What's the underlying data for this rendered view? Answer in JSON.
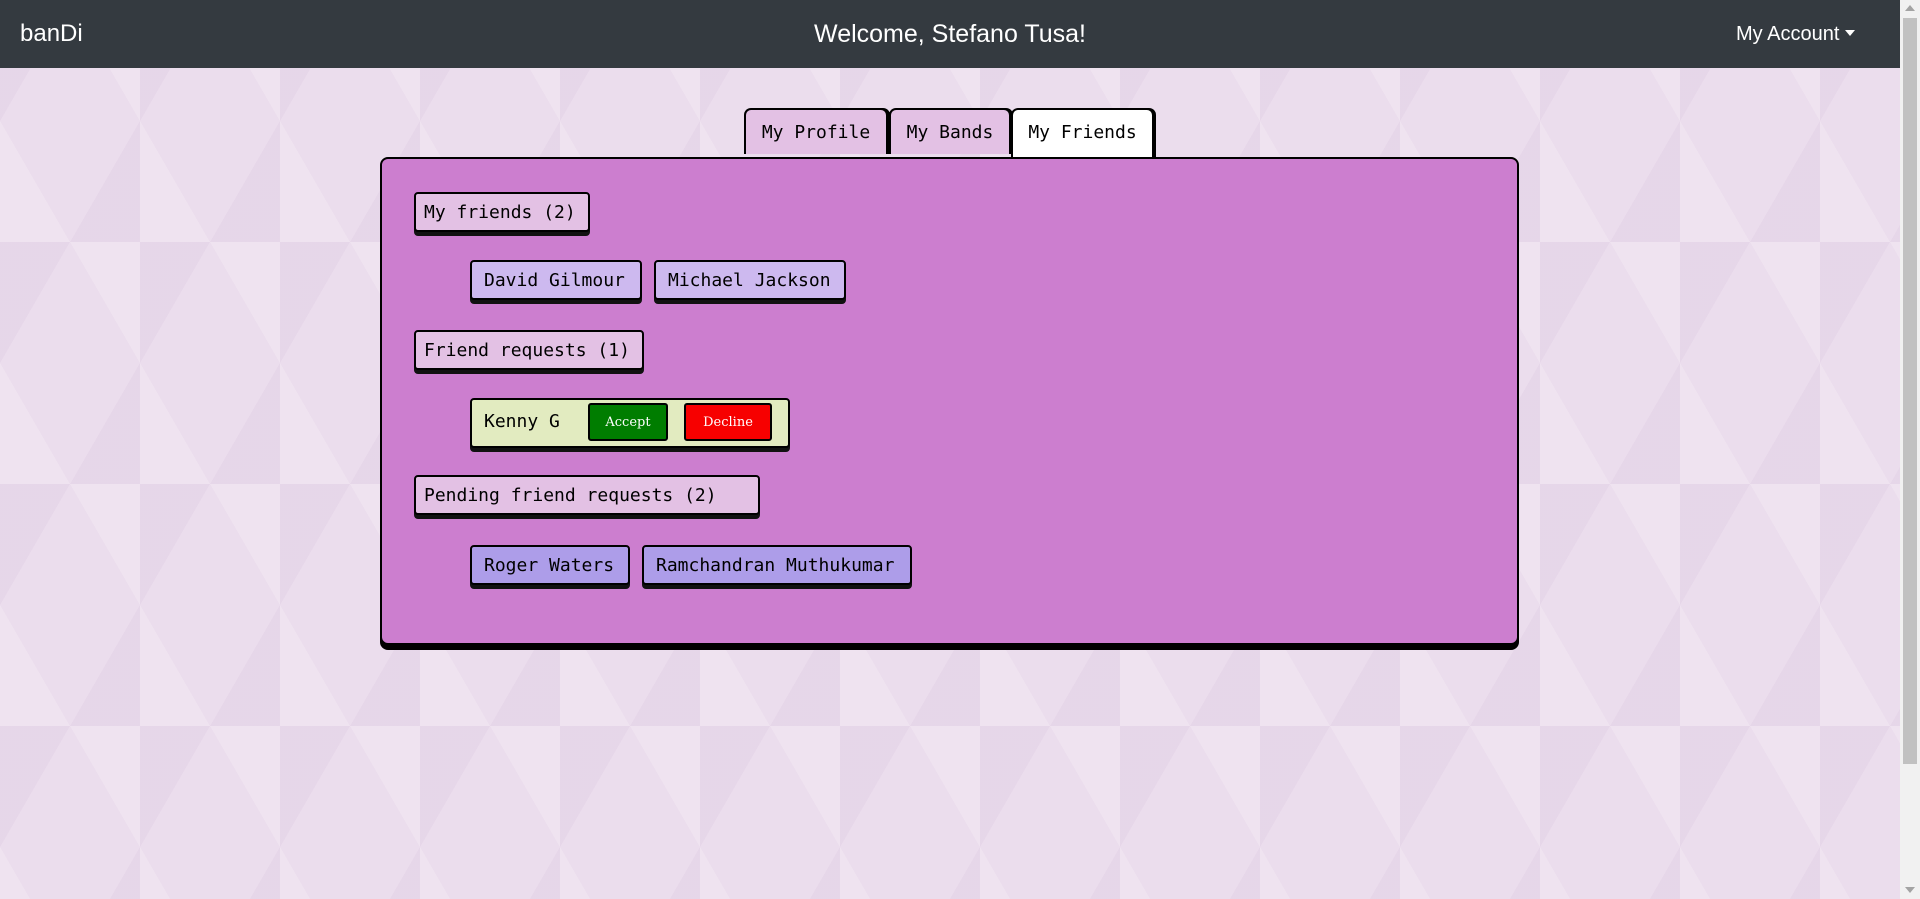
{
  "header": {
    "brand": "banDi",
    "welcome": "Welcome, Stefano Tusa!",
    "account_label": "My Account"
  },
  "tabs": [
    {
      "label": "My Profile",
      "active": false
    },
    {
      "label": "My Bands",
      "active": false
    },
    {
      "label": "My Friends",
      "active": true
    }
  ],
  "friends": {
    "title": "My friends (2)",
    "items": [
      "David Gilmour",
      "Michael Jackson"
    ]
  },
  "requests": {
    "title": "Friend requests (1)",
    "items": [
      {
        "name": "Kenny G",
        "accept_label": "Accept",
        "decline_label": "Decline"
      }
    ]
  },
  "pending": {
    "title": "Pending friend requests (2)",
    "items": [
      "Roger Waters",
      "Ramchandran Muthukumar"
    ]
  },
  "colors": {
    "navbar": "#343a40",
    "panel": "#cc7ecf",
    "tab": "#e3c1e4",
    "friend_chip": "#cdb9ef",
    "pending_chip": "#ad9de9",
    "request_card": "#e2ebc0",
    "accept": "#007d00",
    "decline": "#f70000"
  }
}
